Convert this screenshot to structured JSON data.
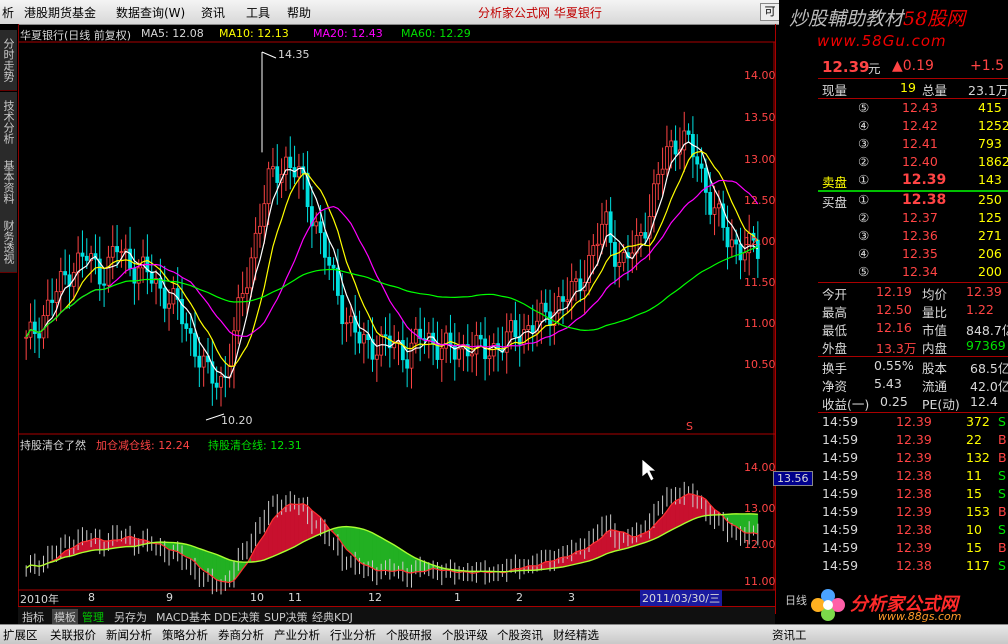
{
  "menubar": {
    "items": [
      "析",
      "港股期货基金",
      "数据查询(W)",
      "资讯",
      "工具",
      "帮助"
    ],
    "center_text": "分析家公式网  华夏银行",
    "window_button": "可"
  },
  "banner": {
    "line1_a": "炒股輔助教材",
    "line1_b": "58股网",
    "line2": "www.58Gu.com"
  },
  "left_tabs": [
    "分时走势",
    "技术分析",
    "基本资料",
    "财务透视"
  ],
  "main_chart": {
    "title": "华夏银行(日线 前复权)",
    "ma5": "MA5: 12.08",
    "ma10": "MA10: 12.13",
    "ma20": "MA20: 12.43",
    "ma60": "MA60: 12.29",
    "high_label": "14.35",
    "low_label": "10.20",
    "marker": "S",
    "y_ticks": [
      "14.00",
      "13.50",
      "13.00",
      "12.50",
      "12.00",
      "11.50",
      "11.00",
      "10.50"
    ]
  },
  "sub_chart": {
    "title": "持股清仓了然",
    "line1": "加仓减仓线: 12.24",
    "line2": "持股清仓线: 12.31",
    "y_ticks": [
      "14.00",
      "13.00",
      "12.00",
      "11.00"
    ],
    "current_value": "13.56"
  },
  "x_axis": {
    "labels": [
      "2010年",
      "8",
      "9",
      "10",
      "11",
      "12",
      "1",
      "2",
      "3"
    ],
    "cursor_date": "2011/03/30/三",
    "period": "日线"
  },
  "chart_data": {
    "type": "candlestick",
    "title": "华夏银行(日线 前复权)",
    "period": "日线",
    "price_axis_ticks": [
      14.0,
      13.5,
      13.0,
      12.5,
      12.0,
      11.5,
      11.0,
      10.5
    ],
    "ylim": [
      10.2,
      14.35
    ],
    "x_labels": [
      "2010年",
      "8",
      "9",
      "10",
      "11",
      "12",
      "1",
      "2",
      "3"
    ],
    "annotations": [
      "14.35",
      "10.20",
      "S"
    ],
    "series": [
      {
        "name": "MA5",
        "last": 12.08,
        "color": "#ffffff"
      },
      {
        "name": "MA10",
        "last": 12.13,
        "color": "#ffff00"
      },
      {
        "name": "MA20",
        "last": 12.43,
        "color": "#ff00ff"
      },
      {
        "name": "MA60",
        "last": 12.29,
        "color": "#00ff00"
      }
    ],
    "approx_close": [
      11.0,
      11.3,
      11.6,
      11.9,
      12.0,
      11.8,
      12.1,
      11.9,
      11.8,
      11.6,
      11.4,
      11.0,
      10.6,
      10.6,
      11.4,
      12.2,
      12.9,
      13.1,
      12.9,
      12.4,
      11.8,
      11.3,
      11.0,
      11.0,
      11.0,
      10.9,
      11.1,
      11.0,
      10.9,
      11.0,
      10.9,
      11.0,
      11.1,
      11.2,
      11.3,
      11.5,
      11.6,
      12.0,
      12.4,
      11.9,
      12.1,
      12.6,
      13.2,
      13.4,
      13.1,
      12.6,
      12.2,
      12.1,
      12.08
    ]
  },
  "quote": {
    "price": "12.39",
    "price_unit": "元",
    "change": "▲0.19",
    "change_pct": "+1.5",
    "volume_label": "现量",
    "volume": "19",
    "total_label": "总量",
    "total": "23.1万",
    "sell_label": "卖盘",
    "buy_label": "买盘",
    "sell": [
      {
        "rank": "⑤",
        "price": "12.43",
        "qty": "415"
      },
      {
        "rank": "④",
        "price": "12.42",
        "qty": "1252"
      },
      {
        "rank": "③",
        "price": "12.41",
        "qty": "793"
      },
      {
        "rank": "②",
        "price": "12.40",
        "qty": "1862"
      },
      {
        "rank": "①",
        "price": "12.39",
        "qty": "143"
      }
    ],
    "buy": [
      {
        "rank": "①",
        "price": "12.38",
        "qty": "250"
      },
      {
        "rank": "②",
        "price": "12.37",
        "qty": "125"
      },
      {
        "rank": "③",
        "price": "12.36",
        "qty": "271"
      },
      {
        "rank": "④",
        "price": "12.35",
        "qty": "206"
      },
      {
        "rank": "⑤",
        "price": "12.34",
        "qty": "200"
      }
    ],
    "stats": [
      {
        "l1": "今开",
        "v1": "12.19",
        "l2": "均价",
        "v2": "12.39"
      },
      {
        "l1": "最高",
        "v1": "12.50",
        "l2": "量比",
        "v2": "1.22"
      },
      {
        "l1": "最低",
        "v1": "12.16",
        "l2": "市值",
        "v2": "848.7亿"
      },
      {
        "l1": "外盘",
        "v1": "13.3万",
        "l2": "内盘",
        "v2": "97369"
      }
    ],
    "fund": [
      {
        "l1": "换手",
        "v1": "0.55%",
        "l2": "股本",
        "v2": "68.5亿"
      },
      {
        "l1": "净资",
        "v1": "5.43",
        "l2": "流通",
        "v2": "42.0亿"
      },
      {
        "l1": "收益(一)",
        "v1": "0.25",
        "l2": "PE(动)",
        "v2": "12.4"
      }
    ],
    "ticks": [
      {
        "time": "14:59",
        "price": "12.39",
        "vol": "372",
        "side": "S"
      },
      {
        "time": "14:59",
        "price": "12.39",
        "vol": "22",
        "side": "B"
      },
      {
        "time": "14:59",
        "price": "12.39",
        "vol": "132",
        "side": "B"
      },
      {
        "time": "14:59",
        "price": "12.38",
        "vol": "11",
        "side": "S"
      },
      {
        "time": "14:59",
        "price": "12.38",
        "vol": "15",
        "side": "S"
      },
      {
        "time": "14:59",
        "price": "12.39",
        "vol": "153",
        "side": "B"
      },
      {
        "time": "14:59",
        "price": "12.38",
        "vol": "10",
        "side": "S"
      },
      {
        "time": "14:59",
        "price": "12.39",
        "vol": "15",
        "side": "B"
      },
      {
        "time": "14:59",
        "price": "12.38",
        "vol": "117",
        "side": "S"
      }
    ]
  },
  "tabbar": [
    "指标",
    "模板",
    "管理",
    "另存为",
    "MACD基本",
    "DDE决策",
    "SUP决策",
    "经典KDJ"
  ],
  "statusbar": [
    "扩展区",
    "关联报价",
    "新闻分析",
    "策略分析",
    "券商分析",
    "产业分析",
    "行业分析",
    "个股研报",
    "个股评级",
    "个股资讯",
    "财经精选",
    "资讯工"
  ],
  "logo": {
    "text": "分析家公式网",
    "url": "www.88gs.com"
  },
  "colors": {
    "up": "#ff4444",
    "down": "#00e000",
    "ma5": "#ffffff",
    "ma10": "#ffff00",
    "ma20": "#ff00ff",
    "ma60": "#00ff00",
    "fill_red": "#c8102e",
    "fill_green": "#22b022"
  }
}
